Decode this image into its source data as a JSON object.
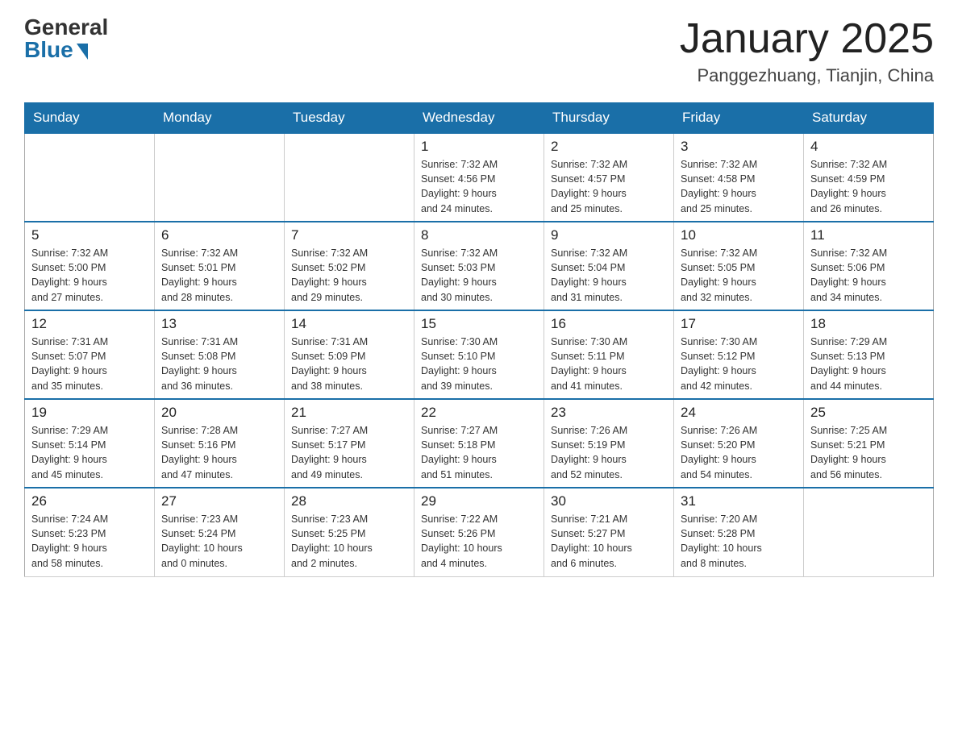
{
  "logo": {
    "general": "General",
    "blue": "Blue"
  },
  "title": "January 2025",
  "location": "Panggezhuang, Tianjin, China",
  "days_of_week": [
    "Sunday",
    "Monday",
    "Tuesday",
    "Wednesday",
    "Thursday",
    "Friday",
    "Saturday"
  ],
  "weeks": [
    [
      {
        "day": "",
        "info": ""
      },
      {
        "day": "",
        "info": ""
      },
      {
        "day": "",
        "info": ""
      },
      {
        "day": "1",
        "info": "Sunrise: 7:32 AM\nSunset: 4:56 PM\nDaylight: 9 hours\nand 24 minutes."
      },
      {
        "day": "2",
        "info": "Sunrise: 7:32 AM\nSunset: 4:57 PM\nDaylight: 9 hours\nand 25 minutes."
      },
      {
        "day": "3",
        "info": "Sunrise: 7:32 AM\nSunset: 4:58 PM\nDaylight: 9 hours\nand 25 minutes."
      },
      {
        "day": "4",
        "info": "Sunrise: 7:32 AM\nSunset: 4:59 PM\nDaylight: 9 hours\nand 26 minutes."
      }
    ],
    [
      {
        "day": "5",
        "info": "Sunrise: 7:32 AM\nSunset: 5:00 PM\nDaylight: 9 hours\nand 27 minutes."
      },
      {
        "day": "6",
        "info": "Sunrise: 7:32 AM\nSunset: 5:01 PM\nDaylight: 9 hours\nand 28 minutes."
      },
      {
        "day": "7",
        "info": "Sunrise: 7:32 AM\nSunset: 5:02 PM\nDaylight: 9 hours\nand 29 minutes."
      },
      {
        "day": "8",
        "info": "Sunrise: 7:32 AM\nSunset: 5:03 PM\nDaylight: 9 hours\nand 30 minutes."
      },
      {
        "day": "9",
        "info": "Sunrise: 7:32 AM\nSunset: 5:04 PM\nDaylight: 9 hours\nand 31 minutes."
      },
      {
        "day": "10",
        "info": "Sunrise: 7:32 AM\nSunset: 5:05 PM\nDaylight: 9 hours\nand 32 minutes."
      },
      {
        "day": "11",
        "info": "Sunrise: 7:32 AM\nSunset: 5:06 PM\nDaylight: 9 hours\nand 34 minutes."
      }
    ],
    [
      {
        "day": "12",
        "info": "Sunrise: 7:31 AM\nSunset: 5:07 PM\nDaylight: 9 hours\nand 35 minutes."
      },
      {
        "day": "13",
        "info": "Sunrise: 7:31 AM\nSunset: 5:08 PM\nDaylight: 9 hours\nand 36 minutes."
      },
      {
        "day": "14",
        "info": "Sunrise: 7:31 AM\nSunset: 5:09 PM\nDaylight: 9 hours\nand 38 minutes."
      },
      {
        "day": "15",
        "info": "Sunrise: 7:30 AM\nSunset: 5:10 PM\nDaylight: 9 hours\nand 39 minutes."
      },
      {
        "day": "16",
        "info": "Sunrise: 7:30 AM\nSunset: 5:11 PM\nDaylight: 9 hours\nand 41 minutes."
      },
      {
        "day": "17",
        "info": "Sunrise: 7:30 AM\nSunset: 5:12 PM\nDaylight: 9 hours\nand 42 minutes."
      },
      {
        "day": "18",
        "info": "Sunrise: 7:29 AM\nSunset: 5:13 PM\nDaylight: 9 hours\nand 44 minutes."
      }
    ],
    [
      {
        "day": "19",
        "info": "Sunrise: 7:29 AM\nSunset: 5:14 PM\nDaylight: 9 hours\nand 45 minutes."
      },
      {
        "day": "20",
        "info": "Sunrise: 7:28 AM\nSunset: 5:16 PM\nDaylight: 9 hours\nand 47 minutes."
      },
      {
        "day": "21",
        "info": "Sunrise: 7:27 AM\nSunset: 5:17 PM\nDaylight: 9 hours\nand 49 minutes."
      },
      {
        "day": "22",
        "info": "Sunrise: 7:27 AM\nSunset: 5:18 PM\nDaylight: 9 hours\nand 51 minutes."
      },
      {
        "day": "23",
        "info": "Sunrise: 7:26 AM\nSunset: 5:19 PM\nDaylight: 9 hours\nand 52 minutes."
      },
      {
        "day": "24",
        "info": "Sunrise: 7:26 AM\nSunset: 5:20 PM\nDaylight: 9 hours\nand 54 minutes."
      },
      {
        "day": "25",
        "info": "Sunrise: 7:25 AM\nSunset: 5:21 PM\nDaylight: 9 hours\nand 56 minutes."
      }
    ],
    [
      {
        "day": "26",
        "info": "Sunrise: 7:24 AM\nSunset: 5:23 PM\nDaylight: 9 hours\nand 58 minutes."
      },
      {
        "day": "27",
        "info": "Sunrise: 7:23 AM\nSunset: 5:24 PM\nDaylight: 10 hours\nand 0 minutes."
      },
      {
        "day": "28",
        "info": "Sunrise: 7:23 AM\nSunset: 5:25 PM\nDaylight: 10 hours\nand 2 minutes."
      },
      {
        "day": "29",
        "info": "Sunrise: 7:22 AM\nSunset: 5:26 PM\nDaylight: 10 hours\nand 4 minutes."
      },
      {
        "day": "30",
        "info": "Sunrise: 7:21 AM\nSunset: 5:27 PM\nDaylight: 10 hours\nand 6 minutes."
      },
      {
        "day": "31",
        "info": "Sunrise: 7:20 AM\nSunset: 5:28 PM\nDaylight: 10 hours\nand 8 minutes."
      },
      {
        "day": "",
        "info": ""
      }
    ]
  ]
}
